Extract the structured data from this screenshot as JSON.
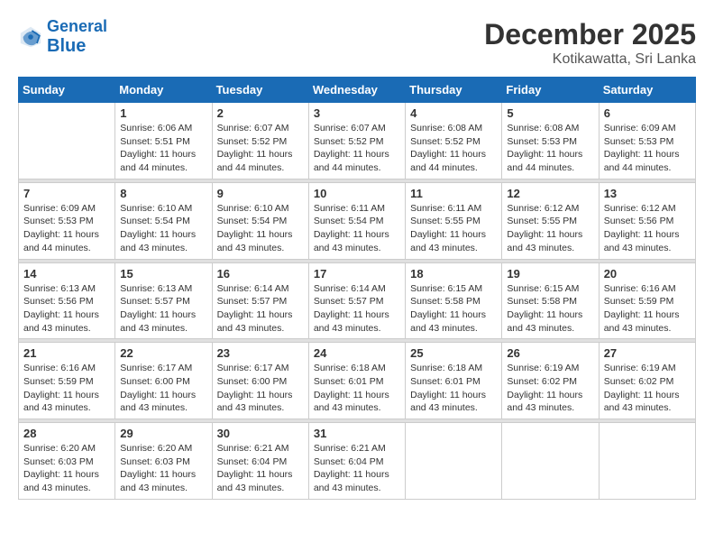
{
  "header": {
    "logo_line1": "General",
    "logo_line2": "Blue",
    "month_year": "December 2025",
    "location": "Kotikawatta, Sri Lanka"
  },
  "weekdays": [
    "Sunday",
    "Monday",
    "Tuesday",
    "Wednesday",
    "Thursday",
    "Friday",
    "Saturday"
  ],
  "weeks": [
    [
      {
        "day": "",
        "sunrise": "",
        "sunset": "",
        "daylight": ""
      },
      {
        "day": "1",
        "sunrise": "Sunrise: 6:06 AM",
        "sunset": "Sunset: 5:51 PM",
        "daylight": "Daylight: 11 hours and 44 minutes."
      },
      {
        "day": "2",
        "sunrise": "Sunrise: 6:07 AM",
        "sunset": "Sunset: 5:52 PM",
        "daylight": "Daylight: 11 hours and 44 minutes."
      },
      {
        "day": "3",
        "sunrise": "Sunrise: 6:07 AM",
        "sunset": "Sunset: 5:52 PM",
        "daylight": "Daylight: 11 hours and 44 minutes."
      },
      {
        "day": "4",
        "sunrise": "Sunrise: 6:08 AM",
        "sunset": "Sunset: 5:52 PM",
        "daylight": "Daylight: 11 hours and 44 minutes."
      },
      {
        "day": "5",
        "sunrise": "Sunrise: 6:08 AM",
        "sunset": "Sunset: 5:53 PM",
        "daylight": "Daylight: 11 hours and 44 minutes."
      },
      {
        "day": "6",
        "sunrise": "Sunrise: 6:09 AM",
        "sunset": "Sunset: 5:53 PM",
        "daylight": "Daylight: 11 hours and 44 minutes."
      }
    ],
    [
      {
        "day": "7",
        "sunrise": "Sunrise: 6:09 AM",
        "sunset": "Sunset: 5:53 PM",
        "daylight": "Daylight: 11 hours and 44 minutes."
      },
      {
        "day": "8",
        "sunrise": "Sunrise: 6:10 AM",
        "sunset": "Sunset: 5:54 PM",
        "daylight": "Daylight: 11 hours and 43 minutes."
      },
      {
        "day": "9",
        "sunrise": "Sunrise: 6:10 AM",
        "sunset": "Sunset: 5:54 PM",
        "daylight": "Daylight: 11 hours and 43 minutes."
      },
      {
        "day": "10",
        "sunrise": "Sunrise: 6:11 AM",
        "sunset": "Sunset: 5:54 PM",
        "daylight": "Daylight: 11 hours and 43 minutes."
      },
      {
        "day": "11",
        "sunrise": "Sunrise: 6:11 AM",
        "sunset": "Sunset: 5:55 PM",
        "daylight": "Daylight: 11 hours and 43 minutes."
      },
      {
        "day": "12",
        "sunrise": "Sunrise: 6:12 AM",
        "sunset": "Sunset: 5:55 PM",
        "daylight": "Daylight: 11 hours and 43 minutes."
      },
      {
        "day": "13",
        "sunrise": "Sunrise: 6:12 AM",
        "sunset": "Sunset: 5:56 PM",
        "daylight": "Daylight: 11 hours and 43 minutes."
      }
    ],
    [
      {
        "day": "14",
        "sunrise": "Sunrise: 6:13 AM",
        "sunset": "Sunset: 5:56 PM",
        "daylight": "Daylight: 11 hours and 43 minutes."
      },
      {
        "day": "15",
        "sunrise": "Sunrise: 6:13 AM",
        "sunset": "Sunset: 5:57 PM",
        "daylight": "Daylight: 11 hours and 43 minutes."
      },
      {
        "day": "16",
        "sunrise": "Sunrise: 6:14 AM",
        "sunset": "Sunset: 5:57 PM",
        "daylight": "Daylight: 11 hours and 43 minutes."
      },
      {
        "day": "17",
        "sunrise": "Sunrise: 6:14 AM",
        "sunset": "Sunset: 5:57 PM",
        "daylight": "Daylight: 11 hours and 43 minutes."
      },
      {
        "day": "18",
        "sunrise": "Sunrise: 6:15 AM",
        "sunset": "Sunset: 5:58 PM",
        "daylight": "Daylight: 11 hours and 43 minutes."
      },
      {
        "day": "19",
        "sunrise": "Sunrise: 6:15 AM",
        "sunset": "Sunset: 5:58 PM",
        "daylight": "Daylight: 11 hours and 43 minutes."
      },
      {
        "day": "20",
        "sunrise": "Sunrise: 6:16 AM",
        "sunset": "Sunset: 5:59 PM",
        "daylight": "Daylight: 11 hours and 43 minutes."
      }
    ],
    [
      {
        "day": "21",
        "sunrise": "Sunrise: 6:16 AM",
        "sunset": "Sunset: 5:59 PM",
        "daylight": "Daylight: 11 hours and 43 minutes."
      },
      {
        "day": "22",
        "sunrise": "Sunrise: 6:17 AM",
        "sunset": "Sunset: 6:00 PM",
        "daylight": "Daylight: 11 hours and 43 minutes."
      },
      {
        "day": "23",
        "sunrise": "Sunrise: 6:17 AM",
        "sunset": "Sunset: 6:00 PM",
        "daylight": "Daylight: 11 hours and 43 minutes."
      },
      {
        "day": "24",
        "sunrise": "Sunrise: 6:18 AM",
        "sunset": "Sunset: 6:01 PM",
        "daylight": "Daylight: 11 hours and 43 minutes."
      },
      {
        "day": "25",
        "sunrise": "Sunrise: 6:18 AM",
        "sunset": "Sunset: 6:01 PM",
        "daylight": "Daylight: 11 hours and 43 minutes."
      },
      {
        "day": "26",
        "sunrise": "Sunrise: 6:19 AM",
        "sunset": "Sunset: 6:02 PM",
        "daylight": "Daylight: 11 hours and 43 minutes."
      },
      {
        "day": "27",
        "sunrise": "Sunrise: 6:19 AM",
        "sunset": "Sunset: 6:02 PM",
        "daylight": "Daylight: 11 hours and 43 minutes."
      }
    ],
    [
      {
        "day": "28",
        "sunrise": "Sunrise: 6:20 AM",
        "sunset": "Sunset: 6:03 PM",
        "daylight": "Daylight: 11 hours and 43 minutes."
      },
      {
        "day": "29",
        "sunrise": "Sunrise: 6:20 AM",
        "sunset": "Sunset: 6:03 PM",
        "daylight": "Daylight: 11 hours and 43 minutes."
      },
      {
        "day": "30",
        "sunrise": "Sunrise: 6:21 AM",
        "sunset": "Sunset: 6:04 PM",
        "daylight": "Daylight: 11 hours and 43 minutes."
      },
      {
        "day": "31",
        "sunrise": "Sunrise: 6:21 AM",
        "sunset": "Sunset: 6:04 PM",
        "daylight": "Daylight: 11 hours and 43 minutes."
      },
      {
        "day": "",
        "sunrise": "",
        "sunset": "",
        "daylight": ""
      },
      {
        "day": "",
        "sunrise": "",
        "sunset": "",
        "daylight": ""
      },
      {
        "day": "",
        "sunrise": "",
        "sunset": "",
        "daylight": ""
      }
    ]
  ]
}
